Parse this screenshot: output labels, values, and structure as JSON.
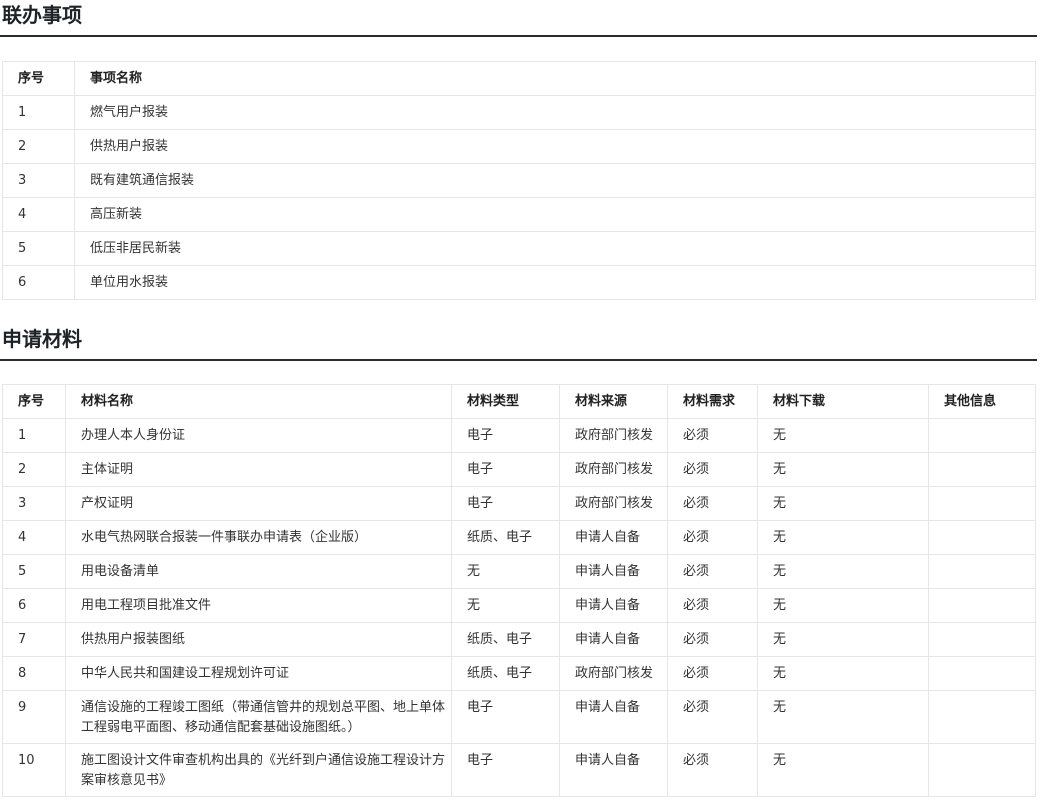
{
  "linked_items": {
    "title": "联办事项",
    "columns": [
      "序号",
      "事项名称"
    ],
    "rows": [
      [
        "1",
        "燃气用户报装"
      ],
      [
        "2",
        "供热用户报装"
      ],
      [
        "3",
        "既有建筑通信报装"
      ],
      [
        "4",
        "高压新装"
      ],
      [
        "5",
        "低压非居民新装"
      ],
      [
        "6",
        "单位用水报装"
      ]
    ]
  },
  "materials": {
    "title": "申请材料",
    "columns": [
      "序号",
      "材料名称",
      "材料类型",
      "材料来源",
      "材料需求",
      "材料下载",
      "其他信息"
    ],
    "rows": [
      [
        "1",
        "办理人本人身份证",
        "电子",
        "政府部门核发",
        "必须",
        "无",
        ""
      ],
      [
        "2",
        "主体证明",
        "电子",
        "政府部门核发",
        "必须",
        "无",
        ""
      ],
      [
        "3",
        "产权证明",
        "电子",
        "政府部门核发",
        "必须",
        "无",
        ""
      ],
      [
        "4",
        "水电气热网联合报装一件事联办申请表（企业版）",
        "纸质、电子",
        "申请人自备",
        "必须",
        "无",
        ""
      ],
      [
        "5",
        "用电设备清单",
        "无",
        "申请人自备",
        "必须",
        "无",
        ""
      ],
      [
        "6",
        "用电工程项目批准文件",
        "无",
        "申请人自备",
        "必须",
        "无",
        ""
      ],
      [
        "7",
        "供热用户报装图纸",
        "纸质、电子",
        "申请人自备",
        "必须",
        "无",
        ""
      ],
      [
        "8",
        "中华人民共和国建设工程规划许可证",
        "纸质、电子",
        "政府部门核发",
        "必须",
        "无",
        ""
      ],
      [
        "9",
        "通信设施的工程竣工图纸（带通信管井的规划总平图、地上单体工程弱电平面图、移动通信配套基础设施图纸。）",
        "电子",
        "申请人自备",
        "必须",
        "无",
        ""
      ],
      [
        "10",
        "施工图设计文件审查机构出具的《光纤到户通信设施工程设计方案审核意见书》",
        "电子",
        "申请人自备",
        "必须",
        "无",
        ""
      ]
    ]
  }
}
